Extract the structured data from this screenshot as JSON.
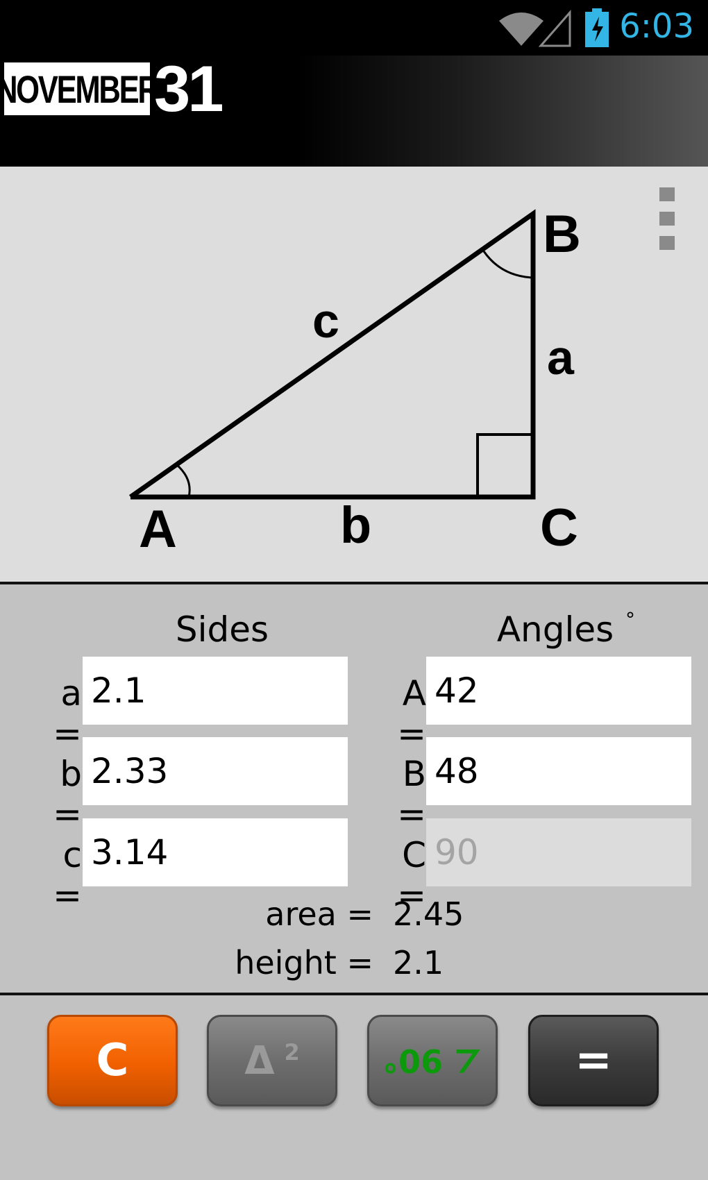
{
  "status_bar": {
    "time": "6:03",
    "wifi_icon": "wifi-icon",
    "signal_icon": "signal-icon",
    "battery_icon": "battery-charging-icon"
  },
  "header": {
    "logo_word": "NOVEMBER",
    "logo_number": "31"
  },
  "diagram": {
    "vertex_a": "A",
    "vertex_b": "B",
    "vertex_c": "C",
    "side_a": "a",
    "side_b": "b",
    "side_c": "c"
  },
  "menu": {
    "icon": "overflow-menu-icon"
  },
  "inputs": {
    "sides_header": "Sides",
    "angles_header": "Angles",
    "degree_symbol": "°",
    "sides": [
      {
        "label": "a =",
        "value": "2.1"
      },
      {
        "label": "b =",
        "value": "2.33"
      },
      {
        "label": "c =",
        "value": "3.14"
      }
    ],
    "angles": [
      {
        "label": "A =",
        "value": "42"
      },
      {
        "label": "B =",
        "value": "48"
      },
      {
        "label": "C =",
        "value": "90",
        "disabled": true
      }
    ]
  },
  "results": {
    "area_label": "area =",
    "area_value": "2.45",
    "height_label": "height =",
    "height_value": "2.1"
  },
  "keypad": {
    "clear": "C",
    "square_symbol": "Δ",
    "square_sup": "2",
    "right_angle": "∠ 90°",
    "equals": "="
  },
  "colors": {
    "accent": "#f06000",
    "clock": "#33b5e5",
    "angle_key_text": "#0c9a0c"
  }
}
